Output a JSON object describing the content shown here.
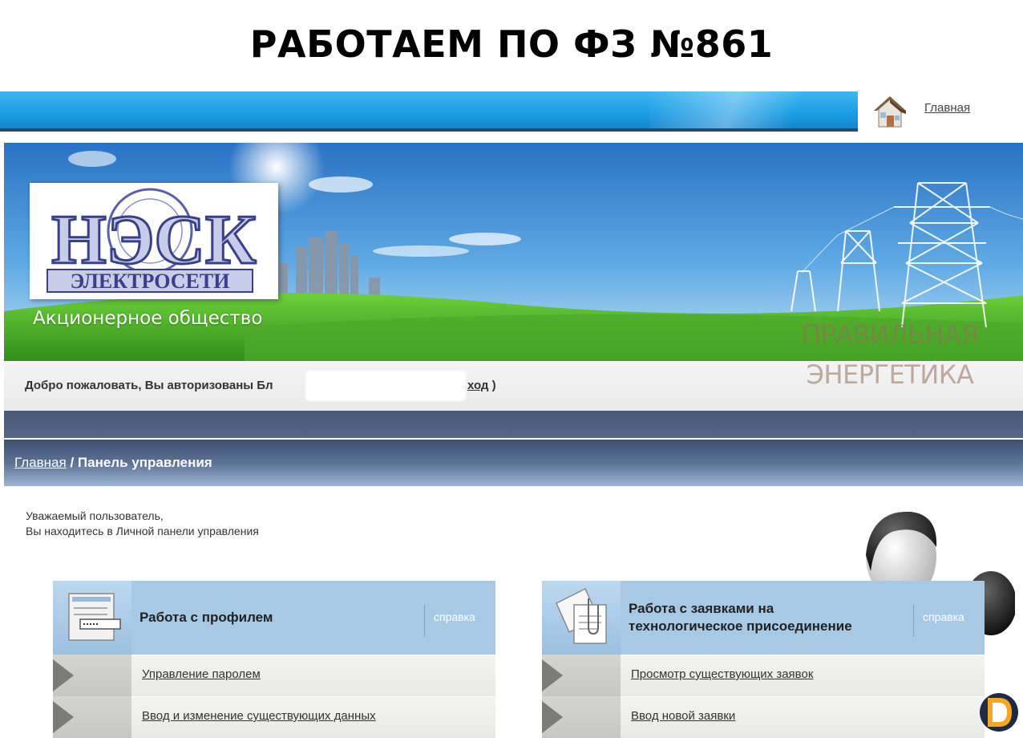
{
  "slide": {
    "title": "РАБОТАЕМ ПО ФЗ №861"
  },
  "header": {
    "home_link": "Главная"
  },
  "banner": {
    "logo_main": "НЭСК",
    "logo_sub": "ЭЛЕКТРОСЕТИ",
    "subtitle": "Акционерное общество",
    "slogan_line1": "ПРАВИЛЬНАЯ",
    "slogan_line2": "ЭНЕРГЕТИКА"
  },
  "welcome": {
    "text": "Добро пожаловать, Вы авторизованы Бл",
    "logout_prefix": "",
    "logout_link": "ход",
    "logout_suffix": ")"
  },
  "breadcrumb": {
    "home": "Главная",
    "separator": " / ",
    "current": "Панель управления"
  },
  "greeting": {
    "line1": "Уважаемый пользователь,",
    "line2": "Вы находитесь в Личной панели управления"
  },
  "panels": [
    {
      "title_line1": "Работа с профилем",
      "title_line2": "",
      "help": "справка",
      "items": [
        "Управление паролем",
        "Ввод и изменение существующих данных"
      ]
    },
    {
      "title_line1": "Работа с заявками на",
      "title_line2": "технологическое присоединение",
      "help": "справка",
      "items": [
        "Просмотр существующих заявок",
        "Ввод новой заявки"
      ]
    }
  ],
  "colors": {
    "topbar": "#1d9ee6",
    "panel_header": "#a8c9e4",
    "breadcrumb_dark": "#3e4f70",
    "corner_logo_orange": "#f5a623"
  }
}
